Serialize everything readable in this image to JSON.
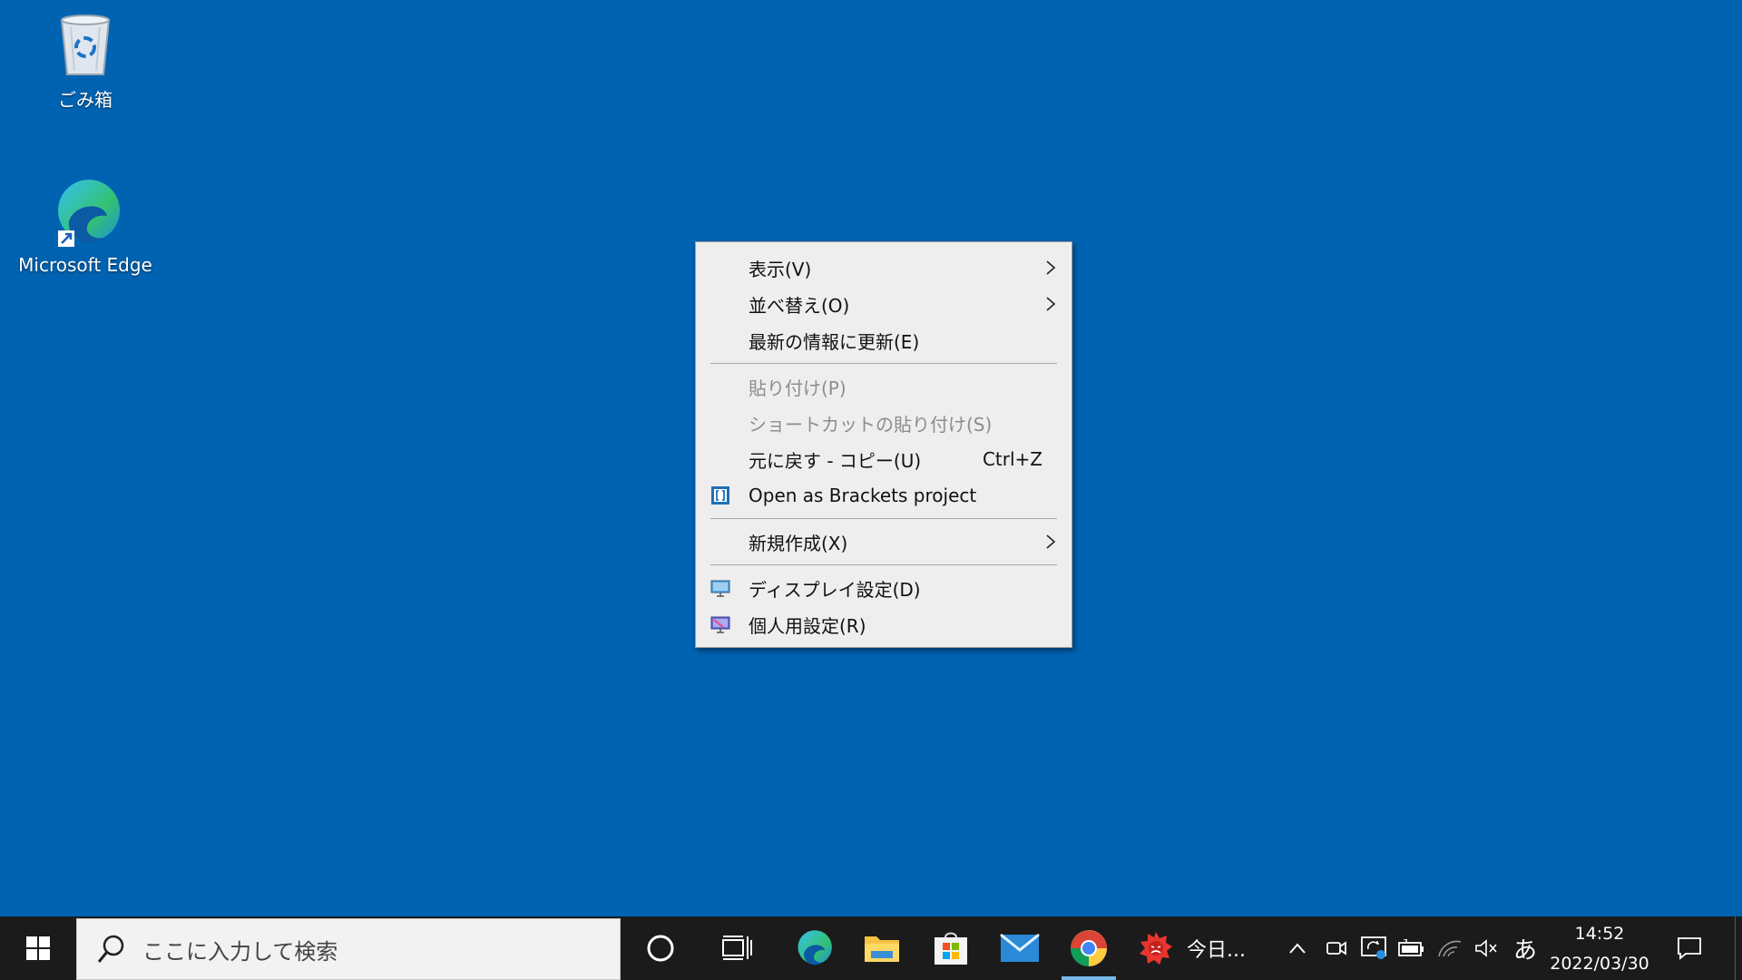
{
  "desktop": {
    "icons": [
      {
        "label": "ごみ箱",
        "icon": "recycle-bin-icon"
      },
      {
        "label": "Microsoft Edge",
        "icon": "edge-icon"
      }
    ]
  },
  "context_menu": {
    "items": [
      {
        "label": "表示(V)",
        "submenu": true
      },
      {
        "label": "並べ替え(O)",
        "submenu": true
      },
      {
        "label": "最新の情報に更新(E)"
      },
      {
        "label": "貼り付け(P)",
        "disabled": true
      },
      {
        "label": "ショートカットの貼り付け(S)",
        "disabled": true
      },
      {
        "label": "元に戻す - コピー(U)",
        "shortcut": "Ctrl+Z"
      },
      {
        "label": "Open as Brackets project",
        "icon": "brackets-icon"
      },
      {
        "label": "新規作成(X)",
        "submenu": true
      },
      {
        "label": "ディスプレイ設定(D)",
        "icon": "display-settings-icon"
      },
      {
        "label": "個人用設定(R)",
        "icon": "personalize-icon"
      }
    ]
  },
  "taskbar": {
    "search_placeholder": "ここに入力して検索",
    "weather_label": "今日...",
    "ime_label": "あ",
    "time": "14:52",
    "date": "2022/03/30"
  },
  "colors": {
    "desktop_bg": "#0063b1",
    "taskbar_bg": "#1b1b1b",
    "menu_bg": "#eeeeee"
  }
}
